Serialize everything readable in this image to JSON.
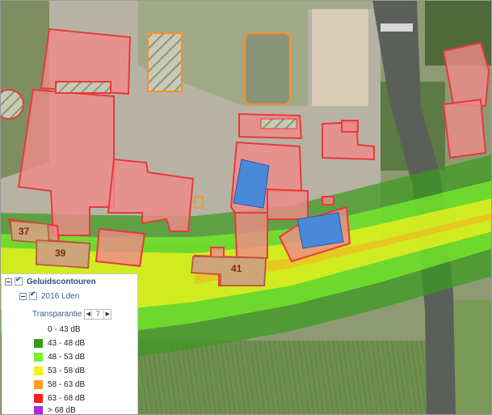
{
  "map": {
    "building_labels": [
      "37",
      "39",
      "41"
    ]
  },
  "legend": {
    "group_title": "Geluidscontouren",
    "layer_title": "2016 Lden",
    "transparency_label": "Transparantie",
    "transparency_value": "7",
    "classes": [
      {
        "label": "0 - 43 dB",
        "color": "#ffffff"
      },
      {
        "label": "43 - 48 dB",
        "color": "#3a9a1e"
      },
      {
        "label": "48 - 53 dB",
        "color": "#7cf02a"
      },
      {
        "label": "53 - 58 dB",
        "color": "#f2f21e"
      },
      {
        "label": "58 - 63 dB",
        "color": "#ff9e1e"
      },
      {
        "label": "63 - 68 dB",
        "color": "#ff1e1e"
      },
      {
        "label": "> 68 dB",
        "color": "#a22ed8"
      }
    ]
  }
}
